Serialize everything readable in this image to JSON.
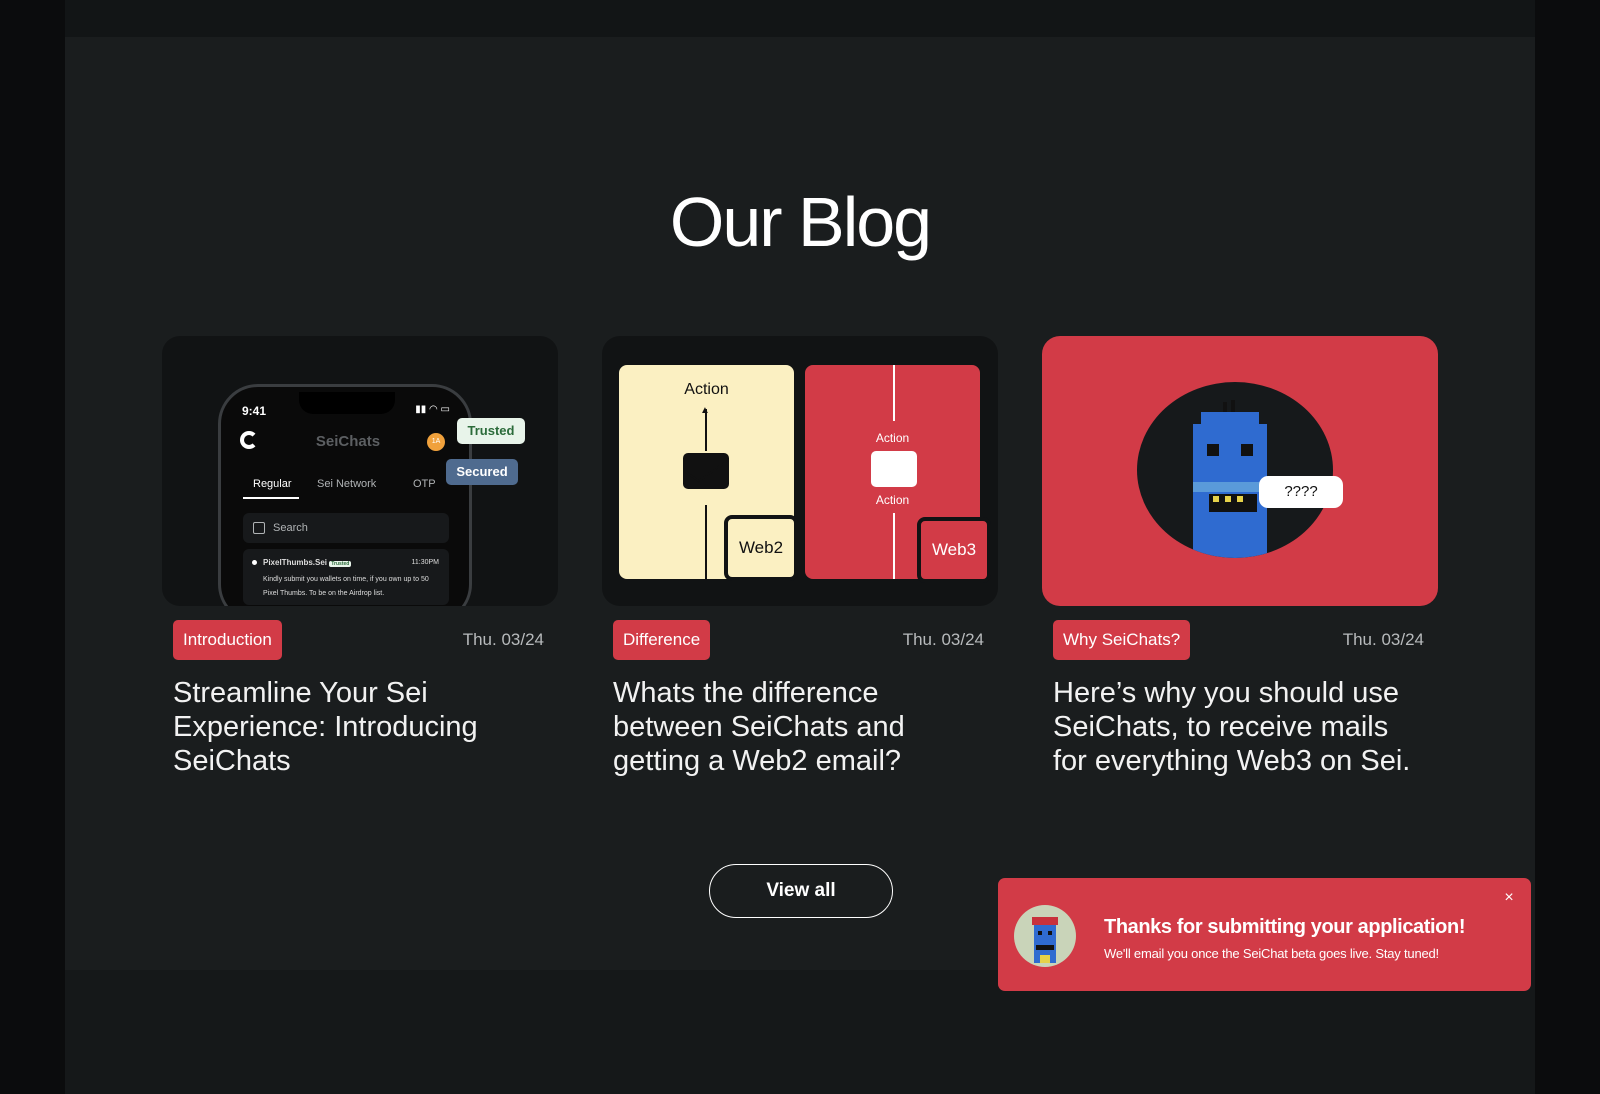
{
  "section": {
    "title": "Our Blog",
    "view_all_label": "View all"
  },
  "cards": [
    {
      "tag": "Introduction",
      "date": "Thu. 03/24",
      "title": "Streamline Your Sei Experience: Introducing SeiChats",
      "thumb": {
        "time": "9:41",
        "app_title": "SeiChats",
        "avatar": "1A",
        "tabs": [
          "Regular",
          "Sei Network",
          "OTP"
        ],
        "search_placeholder": "Search",
        "message_sender": "PixelThumbs.Sei",
        "message_badge": "Trusted",
        "message_time": "11:30PM",
        "message_body": "Kindly submit you wallets on time, if you own up to 50 Pixel Thumbs. To be on the Airdrop list.",
        "pill_trusted": "Trusted",
        "pill_secured": "Secured"
      }
    },
    {
      "tag": "Difference",
      "date": "Thu. 03/24",
      "title": "Whats the difference between SeiChats and getting a Web2 email?",
      "thumb": {
        "left_action": "Action",
        "left_label": "Web2",
        "right_action_top": "Action",
        "right_action_bottom": "Action",
        "right_label": "Web3"
      }
    },
    {
      "tag": "Why SeiChats?",
      "date": "Thu. 03/24",
      "title": "Here’s why you should use SeiChats, to receive mails for everything Web3 on Sei.",
      "thumb": {
        "bubble": "????"
      }
    }
  ],
  "toast": {
    "title": "Thanks for submitting your application!",
    "message": "We'll email you once the SeiChat beta goes live. Stay tuned!",
    "close_icon": "×"
  },
  "colors": {
    "accent": "#d23b47",
    "background": "#1a1d1e",
    "cream": "#fbf0c2"
  }
}
